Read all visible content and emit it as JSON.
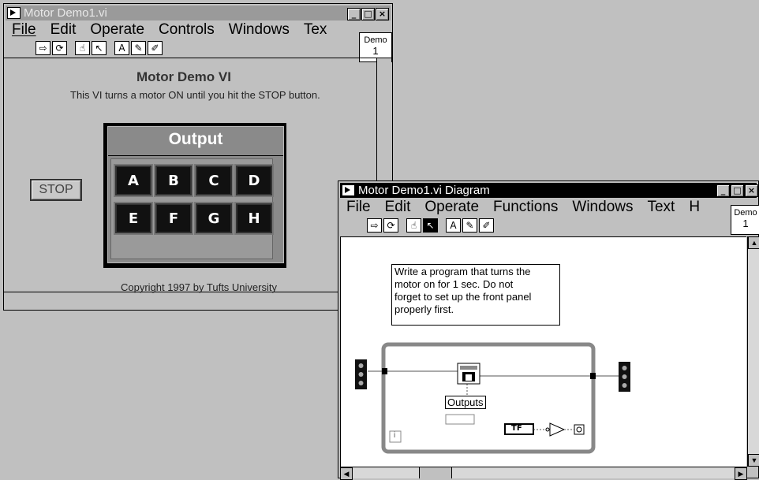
{
  "front": {
    "title": "Motor Demo1.vi",
    "menu": [
      "File",
      "Edit",
      "Operate",
      "Controls",
      "Windows",
      "Tex"
    ],
    "demo": {
      "line1": "Demo",
      "line2": "1"
    },
    "heading": "Motor Demo VI",
    "description": "This VI turns a motor ON until you hit the STOP button.",
    "stop_label": "STOP",
    "output_title": "Output",
    "leds": [
      "A",
      "B",
      "C",
      "D",
      "E",
      "F",
      "G",
      "H"
    ],
    "copyright": "Copyright 1997 by Tufts University"
  },
  "diagram": {
    "title": "Motor Demo1.vi Diagram",
    "menu": [
      "File",
      "Edit",
      "Operate",
      "Functions",
      "Windows",
      "Text",
      "H"
    ],
    "demo": {
      "line1": "Demo",
      "line2": "1"
    },
    "comment": [
      "Write a program that turns the",
      "motor on for 1 sec.  Do not",
      "forget to set up the front panel",
      "properly first."
    ],
    "outputs_label": "Outputs",
    "tf_label": "TF",
    "loop_index": "i"
  },
  "window_buttons": [
    "_",
    "□",
    "×"
  ]
}
